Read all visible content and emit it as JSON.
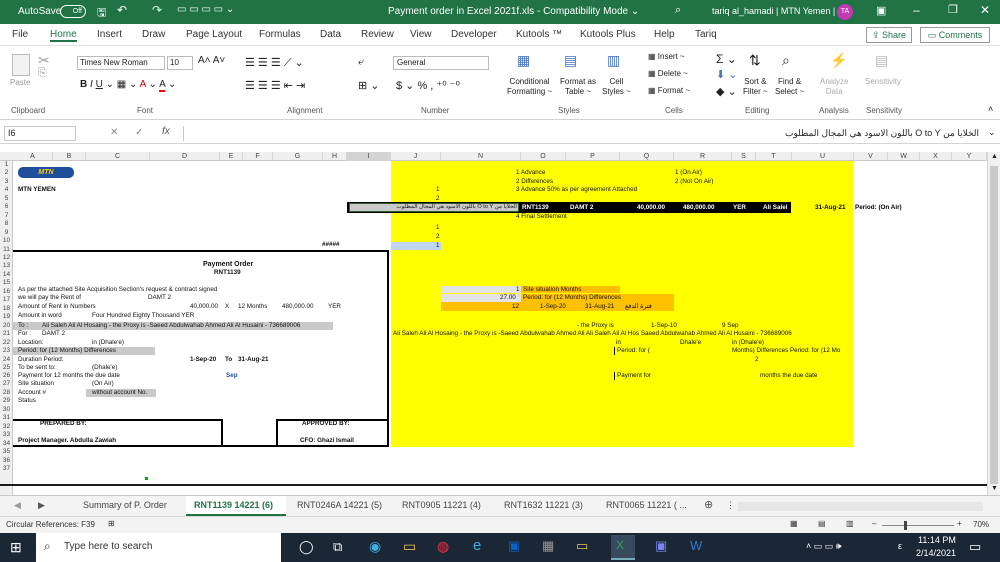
{
  "titlebar": {
    "autosave": "AutoSave",
    "autosave_state": "Off",
    "title": "Payment order in Excel 2021f.xls  -  Compatibility Mode  ⌄",
    "user": "tariq al_hamadi | MTN Yemen |",
    "avatar": "TA"
  },
  "ribbon_tabs": [
    "File",
    "Home",
    "Insert",
    "Draw",
    "Page Layout",
    "Formulas",
    "Data",
    "Review",
    "View",
    "Developer",
    "Kutools ™",
    "Kutools Plus",
    "Help",
    "Tariq"
  ],
  "share_label": "Share",
  "comments_label": "Comments",
  "ribbon": {
    "paste": "Paste",
    "font_name": "Times New Roman",
    "font_size": "10",
    "number_format": "General",
    "conditional": "Conditional\nFormatting ~",
    "cond1": "Conditional",
    "cond2": "Formatting ~",
    "fmt_table1": "Format as",
    "fmt_table2": "Table ~",
    "cell_styles1": "Cell",
    "cell_styles2": "Styles ~",
    "insert": "Insert ~",
    "delete": "Delete ~",
    "format": "Format ~",
    "sort1": "Sort &",
    "sort2": "Filter ~",
    "find1": "Find &",
    "find2": "Select ~",
    "analyze1": "Analyze",
    "analyze2": "Data",
    "sensitivity": "Sensitivity",
    "groups": [
      "Clipboard",
      "Font",
      "Alignment",
      "Number",
      "Styles",
      "Cells",
      "Editing",
      "Analysis",
      "Sensitivity"
    ]
  },
  "formula_bar": {
    "name_box": "I6",
    "fx": "fx",
    "formula": "الخلايا من O to Y باللون الاسود هي المجال المطلوب"
  },
  "columns": [
    "A",
    "B",
    "C",
    "D",
    "E",
    "F",
    "G",
    "H",
    "I",
    "J",
    "N",
    "O",
    "P",
    "Q",
    "R",
    "S",
    "T",
    "U",
    "V",
    "W",
    "X",
    "Y"
  ],
  "rows": [
    "1",
    "2",
    "3",
    "4",
    "5",
    "6",
    "7",
    "8",
    "9",
    "10",
    "11",
    "12",
    "13",
    "14",
    "15",
    "16",
    "17",
    "18",
    "19",
    "20",
    "21",
    "22",
    "23",
    "24",
    "25",
    "26",
    "27",
    "28",
    "29",
    "30",
    "31",
    "32",
    "33",
    "34",
    "35",
    "36",
    "37"
  ],
  "cells": {
    "mtn_logo": "MTN",
    "mtn_yemen": "MTN YEMEN",
    "hashes": "#####",
    "po_title": "Payment Order",
    "po_number": "RNT1139",
    "r15": "As per the attached Site Acquisition Section's request & contract signed",
    "r16": "we will pay the  Rent of",
    "r16b": "DAMT 2",
    "r17a": "Amount of  Rent in Numbers",
    "r17b": "40,000.00",
    "r17c": "X",
    "r17d": "12 Months",
    "r17e": "480,000.00",
    "r17f": "YER",
    "r18a": "Amount in word",
    "r18b": "Four Hundred Eighty  Thousand  YER",
    "r19a": "To :",
    "r19b": "Ali Saleh Ali Al Hosaing  - the Proxy is -Saeed Abdulwahab Ahmed Ali Al Husaini - 736689006",
    "r20a": "For :",
    "r20b": "DAMT 2",
    "r21a": "Location:",
    "r21b": "in (Dhale'e)",
    "r22a": "Period: for (12 Months) Differences",
    "r23a": "Duration Period:",
    "r23b": "1-Sep-20",
    "r23c": "To",
    "r23d": "31-Aug-21",
    "r24a": "To be sent to:",
    "r24b": "(Dhale'e)",
    "r25a": "Payment for 12 months the due date",
    "r25b": "Sep",
    "r26a": "Site situation",
    "r26b": "(On Air)",
    "r27a": "Account #",
    "r27b": "without account No.",
    "r28a": "Status",
    "prepared": "PREPARED BY:",
    "approved": "APPROVED BY:",
    "pm": "Project Manager. Abdulla Zawiah",
    "cfo": "CFO: Ghazi Ismail",
    "j5": "1",
    "j6": "2",
    "j8": "1",
    "j9": "2",
    "j10": "1",
    "o1": "1 Advance",
    "o2": "2 Differences",
    "o3": "3 Advance 50% as per agreement Attached",
    "o7": "4 Final Settlement",
    "r1": "1 (On Air)",
    "r2": "2 (Not On Air)",
    "i6": "الخلايا من O to Y باللون الاسود هي المجال المطلوب",
    "row6_rnt": "RNT1139",
    "row6_damt": "DAMT 2",
    "row6_amt": "40,000.00",
    "row6_total": "480,000.00",
    "row6_yer": "YER",
    "row6_name": "Ali Salel",
    "row6_date": "31-Aug-21",
    "row6_period": "Period:  (On Air)",
    "n15a": "1",
    "n15b": "Site situation   Months",
    "n16a": "27.00",
    "n16b": "Period: for (12 Months) Differences",
    "n17a": "12",
    "n17b": "1-Sep-20",
    "n17c": "31-Aug-21",
    "n17d": "فترة الدفع",
    "n19a": "- the Proxy is",
    "n19b": "1-Sep-10",
    "n19c": "9 Sep",
    "n20": "Ali Saleh Ali Al Hosaing  - the Proxy is -Saeed Abdulwahab Ahmed Ali Ali Saleh Ali Al Hos Saeed Abdulwahab Ahmed Ali Al Husaini - 736689006",
    "n21a": "in",
    "n21b": "Dhale'e",
    "n21c": "in (Dhale'e)",
    "n22a": "Period: for (",
    "n22b": "Months) Differences Period: for (12 Mo",
    "n23": "2",
    "n25a": "Payment for",
    "n25b": "months the due date"
  },
  "sheet_tabs": [
    "Summary of P. Order",
    "RNT1139 14221 (6)",
    "RNT0246A 14221 (5)",
    "RNT0905 11221 (4)",
    "RNT1632 11221 (3)",
    "RNT0065 11221 ( ..."
  ],
  "status": {
    "circular": "Circular References: F39",
    "zoom": "70%"
  },
  "taskbar": {
    "search_placeholder": "Type here to search",
    "time": "11:14 PM",
    "date": "2/14/2021",
    "lang": "ε"
  },
  "colors": {
    "excel_green": "#217346",
    "yellow": "#ffff00",
    "orange": "#ffc000",
    "gray_cell": "#c9c9c9",
    "blue_header": "#1f4e9a"
  }
}
